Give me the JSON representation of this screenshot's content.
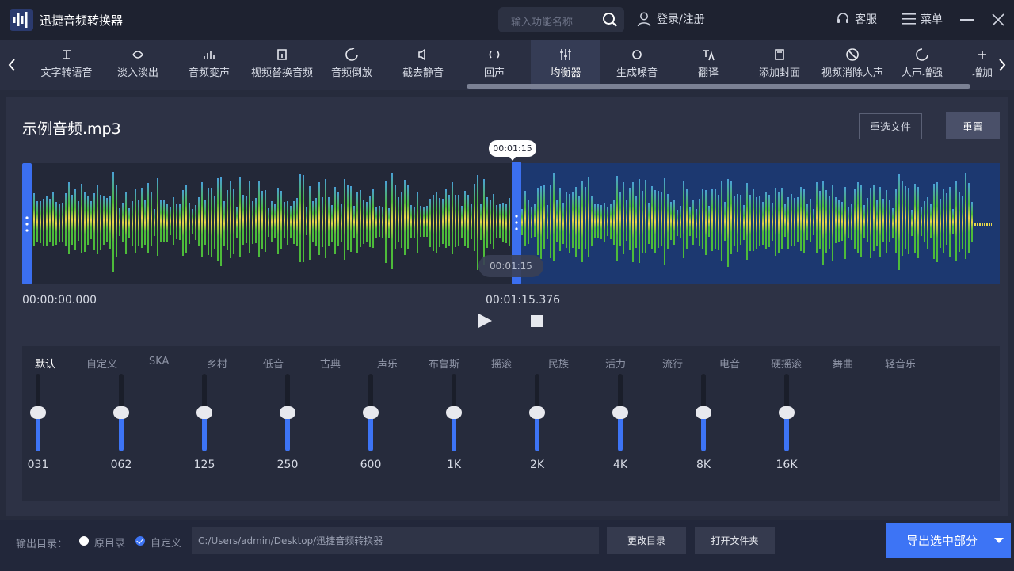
{
  "titlebar": {
    "app_name": "迅捷音频转换器",
    "search_placeholder": "输入功能名称",
    "login": "登录/注册",
    "customer_service": "客服",
    "menu": "菜单"
  },
  "tools": [
    {
      "label": "文字转语音",
      "icon": "text-to-speech-icon"
    },
    {
      "label": "淡入淡出",
      "icon": "fade-icon"
    },
    {
      "label": "音频变声",
      "icon": "voice-change-icon"
    },
    {
      "label": "视频替换音频",
      "icon": "video-replace-audio-icon"
    },
    {
      "label": "音频倒放",
      "icon": "reverse-icon"
    },
    {
      "label": "截去静音",
      "icon": "mute-icon"
    },
    {
      "label": "回声",
      "icon": "echo-icon"
    },
    {
      "label": "均衡器",
      "icon": "equalizer-icon",
      "active": true
    },
    {
      "label": "生成噪音",
      "icon": "noise-icon"
    },
    {
      "label": "翻译",
      "icon": "translate-icon"
    },
    {
      "label": "添加封面",
      "icon": "cover-icon"
    },
    {
      "label": "视频消除人声",
      "icon": "vocal-remove-icon"
    },
    {
      "label": "人声增强",
      "icon": "vocal-enhance-icon"
    },
    {
      "label": "增加",
      "icon": "add-icon"
    }
  ],
  "file": {
    "name": "示例音频.mp3",
    "reselect": "重选文件",
    "reset": "重置"
  },
  "waveform": {
    "playhead_time": "00:01:15",
    "hover_time": "00:01:15",
    "start_time": "00:00:00.000",
    "position_time": "00:01:15.376",
    "colors": {
      "selection": "#1c3870",
      "handle": "#3b6ff0",
      "wave_low": "#4dbb3a",
      "wave_high": "#e8d84a",
      "wave_top": "#4a9fd8"
    }
  },
  "equalizer": {
    "presets": [
      "默认",
      "自定义",
      "SKA",
      "乡村",
      "低音",
      "古典",
      "声乐",
      "布鲁斯",
      "摇滚",
      "民族",
      "活力",
      "流行",
      "电音",
      "硬摇滚",
      "舞曲",
      "轻音乐"
    ],
    "active_preset": "默认",
    "bands": [
      {
        "label": "031",
        "level": 0.5
      },
      {
        "label": "062",
        "level": 0.5
      },
      {
        "label": "125",
        "level": 0.5
      },
      {
        "label": "250",
        "level": 0.5
      },
      {
        "label": "600",
        "level": 0.5
      },
      {
        "label": "1K",
        "level": 0.5
      },
      {
        "label": "2K",
        "level": 0.5
      },
      {
        "label": "4K",
        "level": 0.5
      },
      {
        "label": "8K",
        "level": 0.5
      },
      {
        "label": "16K",
        "level": 0.5
      }
    ]
  },
  "output": {
    "label": "输出目录：",
    "original": "原目录",
    "custom": "自定义",
    "path": "C:/Users/admin/Desktop/迅捷音频转换器",
    "change_dir": "更改目录",
    "open_folder": "打开文件夹",
    "export": "导出选中部分"
  }
}
